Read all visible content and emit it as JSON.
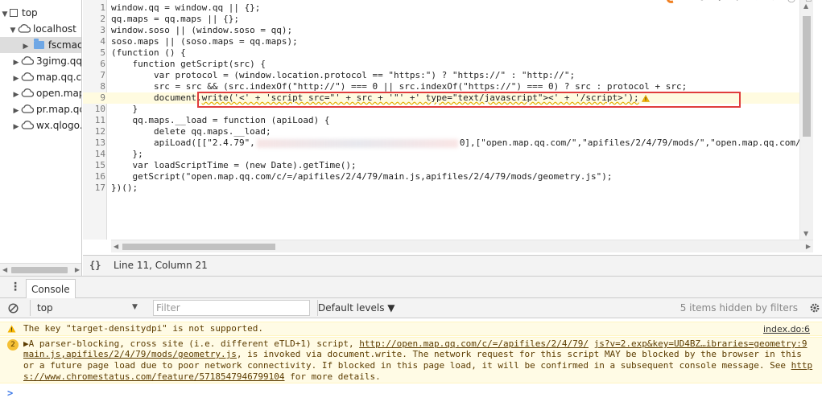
{
  "navigator": {
    "items": [
      {
        "label": "top",
        "icon": "frame-icon",
        "expanded": true
      },
      {
        "label": "localhost",
        "icon": "cloud-icon",
        "expanded": true
      },
      {
        "label": "fscmact",
        "icon": "folder-icon",
        "expanded": false
      },
      {
        "label": "3gimg.qq",
        "icon": "cloud-icon",
        "expanded": false
      },
      {
        "label": "map.qq.co",
        "icon": "cloud-icon",
        "expanded": false
      },
      {
        "label": "open.map",
        "icon": "cloud-icon",
        "expanded": false
      },
      {
        "label": "pr.map.qc",
        "icon": "cloud-icon",
        "expanded": false
      },
      {
        "label": "wx.qlogo.",
        "icon": "cloud-icon",
        "expanded": false
      }
    ]
  },
  "editor": {
    "lines": [
      {
        "n": "1",
        "text": "window.qq = window.qq || {};"
      },
      {
        "n": "2",
        "text": "qq.maps = qq.maps || {};"
      },
      {
        "n": "3",
        "text": "window.soso || (window.soso = qq);"
      },
      {
        "n": "4",
        "text": "soso.maps || (soso.maps = qq.maps);"
      },
      {
        "n": "5",
        "text": "(function () {"
      },
      {
        "n": "6",
        "text": "    function getScript(src) {"
      },
      {
        "n": "7",
        "text": "        var protocol = (window.location.protocol == \"https:\") ? \"https://\" : \"http://\";"
      },
      {
        "n": "8",
        "text": "        src = src && (src.indexOf(\"http://\") === 0 || src.indexOf(\"https://\") === 0) ? src : protocol + src;"
      },
      {
        "n": "9",
        "text_pre": "        document.",
        "text_write": "write('<' + 'script src=\"' + src + '\"' +' type=\"text/javascript\"><' + '/script>');"
      },
      {
        "n": "10",
        "text": "    }"
      },
      {
        "n": "11",
        "text": "    qq.maps.__load = function (apiLoad) {"
      },
      {
        "n": "12",
        "text": "        delete qq.maps.__load;"
      },
      {
        "n": "13",
        "text_pre": "        apiLoad([[\"2.4.79\",",
        "text_post": "0],[\"open.map.qq.com/\",\"apifiles/2/4/79/mods/\",\"open.map.qq.com/"
      },
      {
        "n": "14",
        "text": "    };"
      },
      {
        "n": "15",
        "text": "    var loadScriptTime = (new Date).getTime();"
      },
      {
        "n": "16",
        "text": "    getScript(\"open.map.qq.com/c/=/apifiles/2/4/79/main.js,apifiles/2/4/79/mods/geometry.js\");"
      },
      {
        "n": "17",
        "text": "})();"
      }
    ],
    "current_line": 9,
    "status": "Line 11, Column 21",
    "pretty_print": "{}"
  },
  "drawer": {
    "tab_label": "Console",
    "menu_icon": "⋮"
  },
  "console_toolbar": {
    "context": "top",
    "filter_placeholder": "Filter",
    "levels": "Default levels ▼",
    "hidden": "5 items hidden by filters"
  },
  "messages": {
    "m1": {
      "text": "The key \"target-densitydpi\" is not supported.",
      "source": "index.do:6"
    },
    "m2": {
      "count": "2",
      "line1_pre": "A parser-blocking, cross site (i.e. different eTLD+1) script, ",
      "line1_link": "http://open.map.qq.com/c/=/apifiles/2/4/79/",
      "line1_link2": "js?v=2.exp&key=UD4BZ…ibraries=geometry:9",
      "line2_link": "main.js,apifiles/2/4/79/mods/geometry.js",
      "line2_post": ", is invoked via document.write. The network request for this script MAY be blocked by the browser in this",
      "line3_pre": "or a future page load due to poor network connectivity. If blocked in this page load, it will be confirmed in a subsequent console message. See ",
      "line3_link": "http",
      "line4_link": "s://www.chromestatus.com/feature/5718547946799104",
      "line4_post": " for more details."
    },
    "prompt": ">"
  },
  "colors": {
    "highlight_box": "#e03d3d",
    "warning_bg": "#fffbe5",
    "keyword": "#aa0d91",
    "string": "#1a1aa6"
  }
}
